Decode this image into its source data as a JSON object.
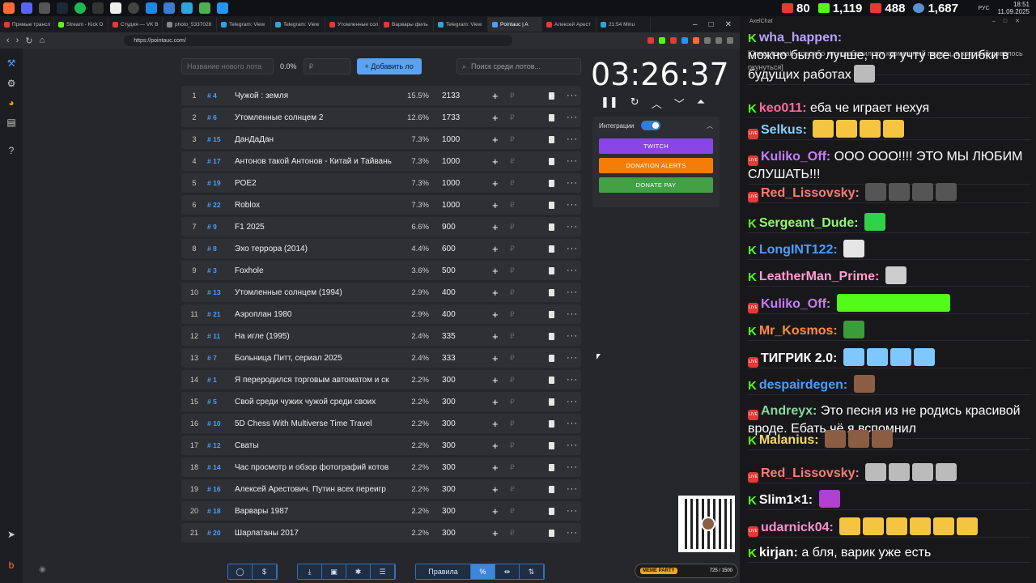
{
  "tray": {
    "time": "18:51",
    "date": "11.09.2025",
    "lang": "РУС"
  },
  "stats": [
    {
      "value": "80",
      "color": "#e53935"
    },
    {
      "value": "1,119",
      "color": "#53fc18"
    },
    {
      "value": "488",
      "color": "#e53935"
    },
    {
      "value": "1,687",
      "color": "#5b8fd6"
    }
  ],
  "browser": {
    "tabs": [
      {
        "label": "Прямые трансл",
        "color": "#e53935"
      },
      {
        "label": "Stream - Kick D",
        "color": "#53fc18"
      },
      {
        "label": "Студия — VK В",
        "color": "#e53935"
      },
      {
        "label": "photo_5337028",
        "color": "#888888"
      },
      {
        "label": "Telegram: View",
        "color": "#2ca5e0"
      },
      {
        "label": "Telegram: View",
        "color": "#2ca5e0"
      },
      {
        "label": "Утомленные сол",
        "color": "#e53935"
      },
      {
        "label": "Варвары филь",
        "color": "#e53935"
      },
      {
        "label": "Telegram: View",
        "color": "#2ca5e0"
      },
      {
        "label": "Pointauc | A",
        "color": "#4a9eff"
      },
      {
        "label": "Алексей Арест",
        "color": "#e53935"
      },
      {
        "label": "21:54 Minu",
        "color": "#2ca5e0"
      }
    ],
    "url": "https://pointauc.com/"
  },
  "toolbar": {
    "new_lot_placeholder": "Название нового лота",
    "percent": "0.0%",
    "amount_placeholder": "₽",
    "add_label": "+  Добавить ло",
    "search_placeholder": "Поиск среди лотов..."
  },
  "lots": [
    {
      "n": "1",
      "id": "# 4",
      "name": "Чужой : земля",
      "pct": "15.5%",
      "amount": "2133"
    },
    {
      "n": "2",
      "id": "# 6",
      "name": "Утомленные солнцем 2",
      "pct": "12.6%",
      "amount": "1733"
    },
    {
      "n": "3",
      "id": "# 15",
      "name": "ДанДаДан",
      "pct": "7.3%",
      "amount": "1000"
    },
    {
      "n": "4",
      "id": "# 17",
      "name": "Антонов такой Антонов - Китай и Тайвань",
      "pct": "7.3%",
      "amount": "1000"
    },
    {
      "n": "5",
      "id": "# 19",
      "name": "POE2",
      "pct": "7.3%",
      "amount": "1000"
    },
    {
      "n": "6",
      "id": "# 22",
      "name": "Roblox",
      "pct": "7.3%",
      "amount": "1000"
    },
    {
      "n": "7",
      "id": "# 9",
      "name": "F1 2025",
      "pct": "6.6%",
      "amount": "900"
    },
    {
      "n": "8",
      "id": "# 8",
      "name": "Эхо террора (2014)",
      "pct": "4.4%",
      "amount": "600"
    },
    {
      "n": "9",
      "id": "# 3",
      "name": "Foxhole",
      "pct": "3.6%",
      "amount": "500"
    },
    {
      "n": "10",
      "id": "# 13",
      "name": "Утомленные солнцем (1994)",
      "pct": "2.9%",
      "amount": "400"
    },
    {
      "n": "11",
      "id": "# 21",
      "name": "Аэроплан 1980",
      "pct": "2.9%",
      "amount": "400"
    },
    {
      "n": "12",
      "id": "# 11",
      "name": "На игле (1995)",
      "pct": "2.4%",
      "amount": "335"
    },
    {
      "n": "13",
      "id": "# 7",
      "name": "Больница Питт, сериал 2025",
      "pct": "2.4%",
      "amount": "333"
    },
    {
      "n": "14",
      "id": "# 1",
      "name": "Я переродился торговым автоматом и ск",
      "pct": "2.2%",
      "amount": "300"
    },
    {
      "n": "15",
      "id": "# 5",
      "name": "Свой среди чужих чужой среди своих",
      "pct": "2.2%",
      "amount": "300"
    },
    {
      "n": "16",
      "id": "# 10",
      "name": "5D Chess With Multiverse Time Travel",
      "pct": "2.2%",
      "amount": "300"
    },
    {
      "n": "17",
      "id": "# 12",
      "name": "Сваты",
      "pct": "2.2%",
      "amount": "300"
    },
    {
      "n": "18",
      "id": "# 14",
      "name": "Час просмотр и обзор фотографий котов",
      "pct": "2.2%",
      "amount": "300"
    },
    {
      "n": "19",
      "id": "# 16",
      "name": "Алексей Арестович. Путин всех переигр",
      "pct": "2.2%",
      "amount": "300"
    },
    {
      "n": "20",
      "id": "# 18",
      "name": "Варвары 1987",
      "pct": "2.2%",
      "amount": "300"
    },
    {
      "n": "21",
      "id": "# 20",
      "name": "Шарлатаны 2017",
      "pct": "2.2%",
      "amount": "300"
    }
  ],
  "timer": {
    "value": "03:26:37"
  },
  "integrations": {
    "label": "Интеграции",
    "twitch": "TWITCH",
    "donation_alerts": "DONATION ALERTS",
    "donate_pay": "DONATE PAY"
  },
  "bottom": {
    "rules_label": "Правила"
  },
  "meme_party": {
    "label": "MEME PARTY",
    "count": "725 / 1500"
  },
  "chat": {
    "app_title": "AxelChat",
    "messages": [
      {
        "platform": "kick",
        "user": "wha_happen:",
        "color": "#b8a4ff",
        "text": "",
        "sub": "[Ответ toxaak: спасибо что разбавил тот кромешный пиздец, в который довелось окунуться]"
      },
      {
        "platform": "none",
        "user": "",
        "color": "#fff",
        "text": "можно было лучше, но я учту все ошибки в будущих работах",
        "sub": ""
      },
      {
        "platform": "kick",
        "user": "keo011:",
        "color": "#ff6b9d",
        "text": "еба че играет нехуя",
        "sub": ""
      },
      {
        "platform": "vk",
        "user": "Selkus:",
        "color": "#7fd1ff",
        "text": "",
        "sub": ""
      },
      {
        "platform": "vk",
        "user": "Kuliko_Off:",
        "color": "#c77dff",
        "text": "ООО ООО!!!! ЭТО МЫ ЛЮБИМ СЛУШАТЬ!!!",
        "sub": ""
      },
      {
        "platform": "vk",
        "user": "Red_Lissovsky:",
        "color": "#ff7b72",
        "text": "",
        "sub": ""
      },
      {
        "platform": "kick",
        "user": "Sergeant_Dude:",
        "color": "#8cff6b",
        "text": "",
        "sub": ""
      },
      {
        "platform": "kick",
        "user": "LongINT122:",
        "color": "#4a9eff",
        "text": "",
        "sub": ""
      },
      {
        "platform": "kick",
        "user": "LeatherMan_Prime:",
        "color": "#ff9ecf",
        "text": "",
        "sub": ""
      },
      {
        "platform": "vk",
        "user": "Kuliko_Off:",
        "color": "#c77dff",
        "text": "",
        "sub": ""
      },
      {
        "platform": "kick",
        "user": "Mr_Kosmos:",
        "color": "#ff8c42",
        "text": "",
        "sub": ""
      },
      {
        "platform": "vk",
        "user": "ТИГРИК 2.0:",
        "color": "#ffffff",
        "text": "",
        "sub": ""
      },
      {
        "platform": "kick",
        "user": "despairdegen:",
        "color": "#4a9eff",
        "text": "",
        "sub": ""
      },
      {
        "platform": "vk",
        "user": "Andreyx:",
        "color": "#8ad6a0",
        "text": "Это песня из не родись красивой вроде. Ебать чё я вспомнил",
        "sub": ""
      },
      {
        "platform": "kick",
        "user": "Malanius:",
        "color": "#f5d76e",
        "text": "",
        "sub": ""
      },
      {
        "platform": "vk",
        "user": "Red_Lissovsky:",
        "color": "#ff7b72",
        "text": "",
        "sub": ""
      },
      {
        "platform": "kick",
        "user": "Slim1×1:",
        "color": "#ffffff",
        "text": "",
        "sub": ""
      },
      {
        "platform": "vk",
        "user": "udarnick04:",
        "color": "#ff8fd1",
        "text": "",
        "sub": ""
      },
      {
        "platform": "kick",
        "user": "kirjan:",
        "color": "#ffffff",
        "text": "а бля, варик уже есть",
        "sub": ""
      }
    ]
  }
}
